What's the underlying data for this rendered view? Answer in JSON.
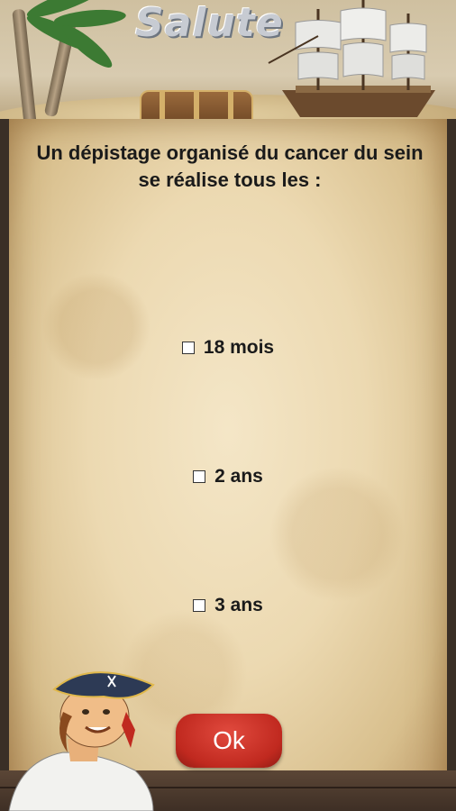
{
  "header": {
    "logo_text": "Salute"
  },
  "quiz": {
    "question": "Un dépistage organisé du cancer du sein se réalise tous les :",
    "answers": [
      {
        "label": "18 mois"
      },
      {
        "label": "2 ans"
      },
      {
        "label": "3 ans"
      }
    ],
    "ok_label": "Ok"
  },
  "colors": {
    "ok_button": "#c0291f",
    "parchment": "#ecd9b1",
    "text": "#1a1a1a"
  }
}
